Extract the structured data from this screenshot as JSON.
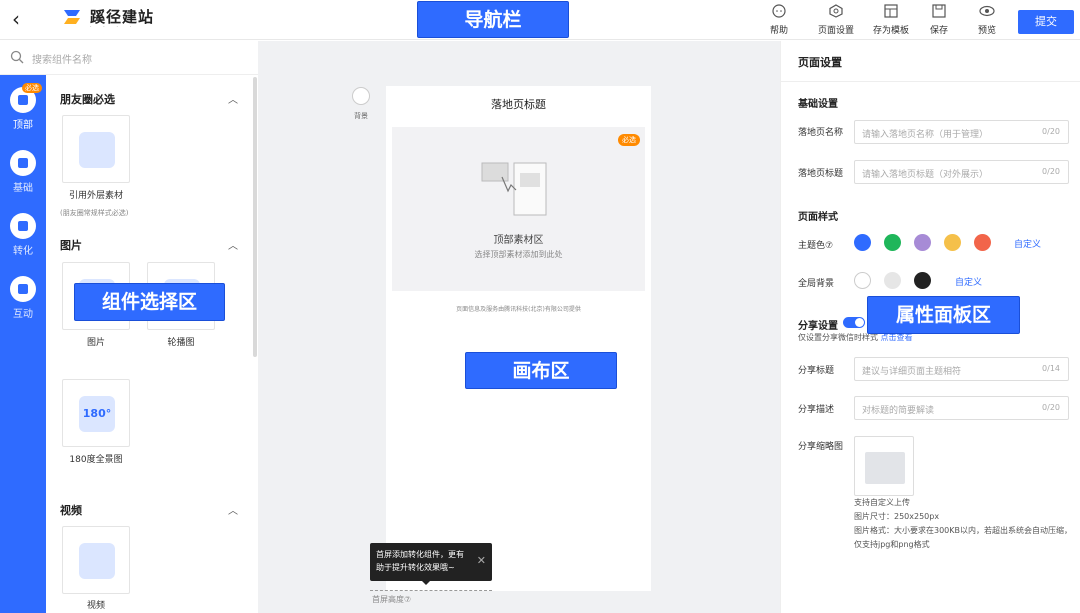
{
  "header": {
    "back_icon": "chevron-left-icon",
    "logo_text": "蹊径建站",
    "nav_annotation": "导航栏",
    "tools": [
      {
        "icon": "help-icon",
        "label": "帮助"
      },
      {
        "icon": "page-settings-icon",
        "label": "页面设置"
      },
      {
        "icon": "template-icon",
        "label": "存为模板"
      },
      {
        "icon": "save-icon",
        "label": "保存"
      },
      {
        "icon": "preview-icon",
        "label": "预览"
      }
    ],
    "submit_label": "提交"
  },
  "search": {
    "placeholder": "搜索组件名称"
  },
  "leftnav": {
    "items": [
      {
        "label": "顶部",
        "badge": "必选"
      },
      {
        "label": "基础"
      },
      {
        "label": "转化"
      },
      {
        "label": "互动"
      }
    ]
  },
  "components": {
    "annotation": "组件选择区",
    "sections": [
      {
        "title": "朋友圈必选",
        "items": [
          {
            "label": "引用外层素材"
          }
        ],
        "note": "(朋友圈常规样式必选)"
      },
      {
        "title": "图片",
        "items": [
          {
            "label": "图片"
          },
          {
            "label": "轮播图"
          },
          {
            "label": "180度全景图",
            "icon_text": "180°"
          }
        ]
      },
      {
        "title": "视频",
        "items": [
          {
            "label": "视频"
          }
        ]
      }
    ]
  },
  "canvas": {
    "annotation": "画布区",
    "background_label": "背景",
    "page_title": "落地页标题",
    "top_area": {
      "badge": "必选",
      "title": "顶部素材区",
      "subtitle": "选择顶部素材添加到此处"
    },
    "footer_note": "页面信息及服务由腾讯科技(北京)有限公司提供",
    "tooltip_line1": "首屏添加转化组件，更有",
    "tooltip_line2": "助于提升转化效果哦~",
    "first_screen_label": "首屏高度⑦"
  },
  "panel": {
    "annotation": "属性面板区",
    "title": "页面设置",
    "basic_title": "基础设置",
    "name_label": "落地页名称",
    "name_placeholder": "请输入落地页名称（用于管理）",
    "name_count": "0/20",
    "title_label": "落地页标题",
    "title_placeholder": "请输入落地页标题（对外展示）",
    "title_count": "0/20",
    "style_title": "页面样式",
    "theme_label": "主题色⑦",
    "theme_colors": [
      "#2f6bff",
      "#1fb65a",
      "#a78bd6",
      "#f5c04a",
      "#f2654a"
    ],
    "custom_label": "自定义",
    "bg_label": "全局背景",
    "bg_colors": [
      "#ffffff",
      "#e6e6e6",
      "#222222"
    ],
    "share_label": "分享设置",
    "share_hint": "仅设置分享微信时样式",
    "share_link": "点击查看",
    "share_title_label": "分享标题",
    "share_title_placeholder": "建议与详细页面主题相符",
    "share_title_count": "0/14",
    "share_desc_label": "分享描述",
    "share_desc_placeholder": "对标题的简要解读",
    "share_desc_count": "0/20",
    "thumb_label": "分享缩略图",
    "thumb_note1": "支持自定义上传",
    "thumb_note2": "图片尺寸：250x250px",
    "thumb_note3": "图片格式：大小要求在300KB以内，若超出系统会自动压缩，仅支持jpg和png格式"
  }
}
